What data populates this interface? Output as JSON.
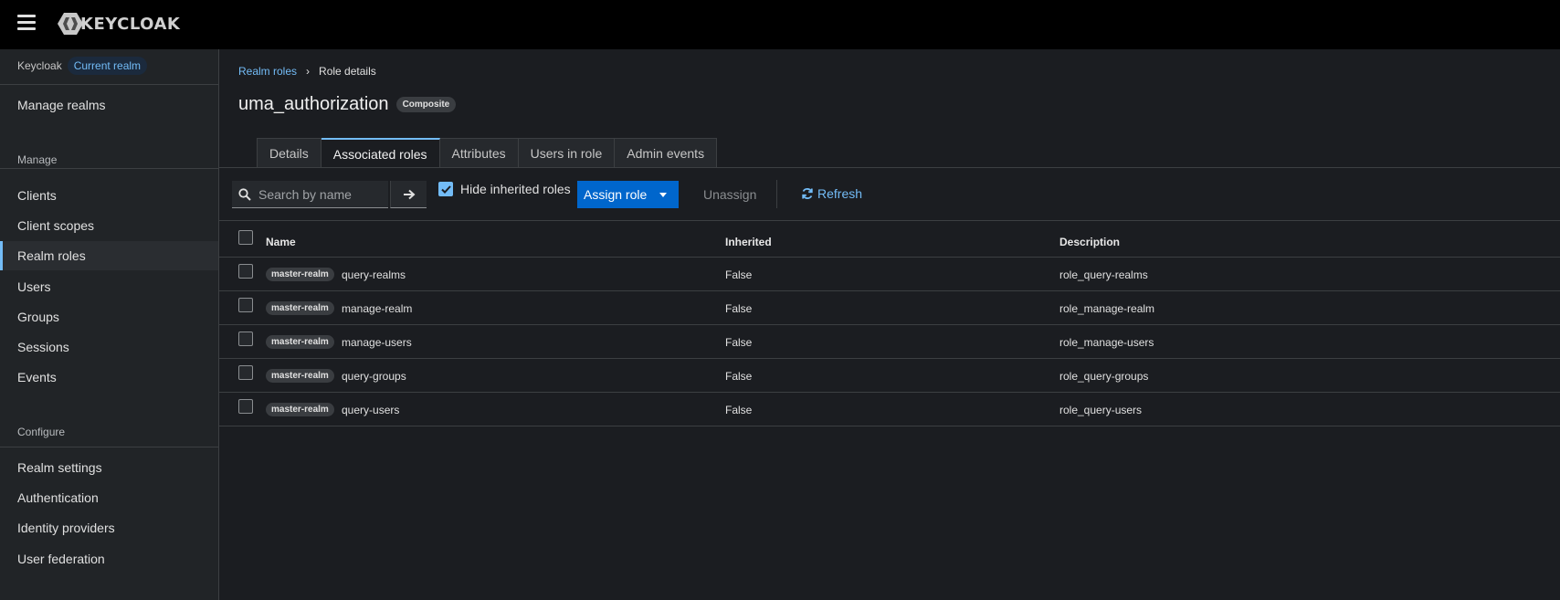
{
  "app": {
    "logo_text": "KEYCLOAK"
  },
  "sidebar": {
    "realm_name": "Keycloak",
    "realm_badge": "Current realm",
    "manage_realms": "Manage realms",
    "section_manage": "Manage",
    "manage_items": [
      "Clients",
      "Client scopes",
      "Realm roles",
      "Users",
      "Groups",
      "Sessions",
      "Events"
    ],
    "section_configure": "Configure",
    "configure_items": [
      "Realm settings",
      "Authentication",
      "Identity providers",
      "User federation"
    ],
    "active_item": "Realm roles"
  },
  "breadcrumb": {
    "parent": "Realm roles",
    "current": "Role details"
  },
  "page": {
    "title": "uma_authorization",
    "label": "Composite"
  },
  "tabs": [
    "Details",
    "Associated roles",
    "Attributes",
    "Users in role",
    "Admin events"
  ],
  "active_tab": "Associated roles",
  "toolbar": {
    "search_placeholder": "Search by name",
    "hide_inherited_label": "Hide inherited roles",
    "hide_inherited_checked": true,
    "assign_role": "Assign role",
    "unassign": "Unassign",
    "refresh": "Refresh"
  },
  "table": {
    "headers": {
      "name": "Name",
      "inherited": "Inherited",
      "description": "Description"
    },
    "rows": [
      {
        "client": "master-realm",
        "name": "query-realms",
        "inherited": "False",
        "description": "role_query-realms"
      },
      {
        "client": "master-realm",
        "name": "manage-realm",
        "inherited": "False",
        "description": "role_manage-realm"
      },
      {
        "client": "master-realm",
        "name": "manage-users",
        "inherited": "False",
        "description": "role_manage-users"
      },
      {
        "client": "master-realm",
        "name": "query-groups",
        "inherited": "False",
        "description": "role_query-groups"
      },
      {
        "client": "master-realm",
        "name": "query-users",
        "inherited": "False",
        "description": "role_query-users"
      }
    ]
  },
  "colors": {
    "accent": "#73bcf7",
    "primary": "#0066cc",
    "masthead": "#000000",
    "background": "#1b1d21",
    "sidebar": "#212427"
  }
}
